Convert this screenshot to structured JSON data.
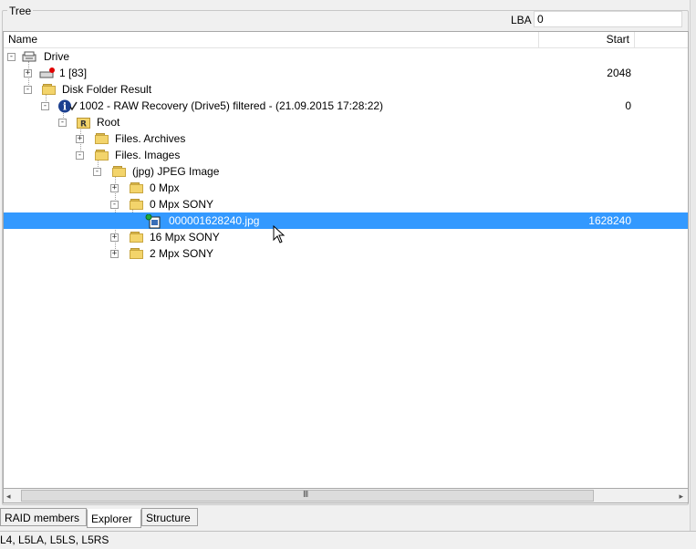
{
  "group": {
    "title": "Tree"
  },
  "lba": {
    "label": "LBA",
    "value": "0"
  },
  "columns": {
    "name": "Name",
    "start": "Start"
  },
  "tree": [
    {
      "label": "Drive",
      "start": "",
      "icon": "drive-icon",
      "expander": "-"
    },
    {
      "label": "1 [83]",
      "start": "2048",
      "icon": "partition-disk-icon",
      "expander": "+"
    },
    {
      "label": "Disk Folder Result",
      "start": "",
      "icon": "folder-icon",
      "expander": "-"
    },
    {
      "label": "1002 - RAW Recovery (Drive5) filtered - (21.09.2015 17:28:22)",
      "start": "0",
      "icon": "info-icon",
      "expander": "-"
    },
    {
      "label": "Root",
      "start": "",
      "icon": "root-folder-icon",
      "expander": "-"
    },
    {
      "label": "Files. Archives",
      "start": "",
      "icon": "folder-icon",
      "expander": "+"
    },
    {
      "label": "Files. Images",
      "start": "",
      "icon": "folder-icon",
      "expander": "-"
    },
    {
      "label": "(jpg) JPEG Image",
      "start": "",
      "icon": "folder-icon",
      "expander": "-"
    },
    {
      "label": "0 Mpx",
      "start": "",
      "icon": "folder-icon",
      "expander": "+"
    },
    {
      "label": "0 Mpx SONY",
      "start": "",
      "icon": "folder-icon",
      "expander": "-"
    },
    {
      "label": "000001628240.jpg",
      "start": "1628240",
      "icon": "jpeg-file-icon",
      "expander": ""
    },
    {
      "label": "16 Mpx SONY",
      "start": "",
      "icon": "folder-icon",
      "expander": "+"
    },
    {
      "label": "2 Mpx SONY",
      "start": "",
      "icon": "folder-icon",
      "expander": "+"
    }
  ],
  "scrollbar": {
    "left_arrow": "◂",
    "right_arrow": "▸",
    "grip": "III"
  },
  "tabs": [
    {
      "label": "RAID members",
      "active": false
    },
    {
      "label": "Explorer",
      "active": true
    },
    {
      "label": "Structure",
      "active": false
    }
  ],
  "status": {
    "text": "L4, L5LA, L5LS, L5RS"
  },
  "colors": {
    "selection": "#3399ff",
    "folder": "#f3d46b"
  }
}
